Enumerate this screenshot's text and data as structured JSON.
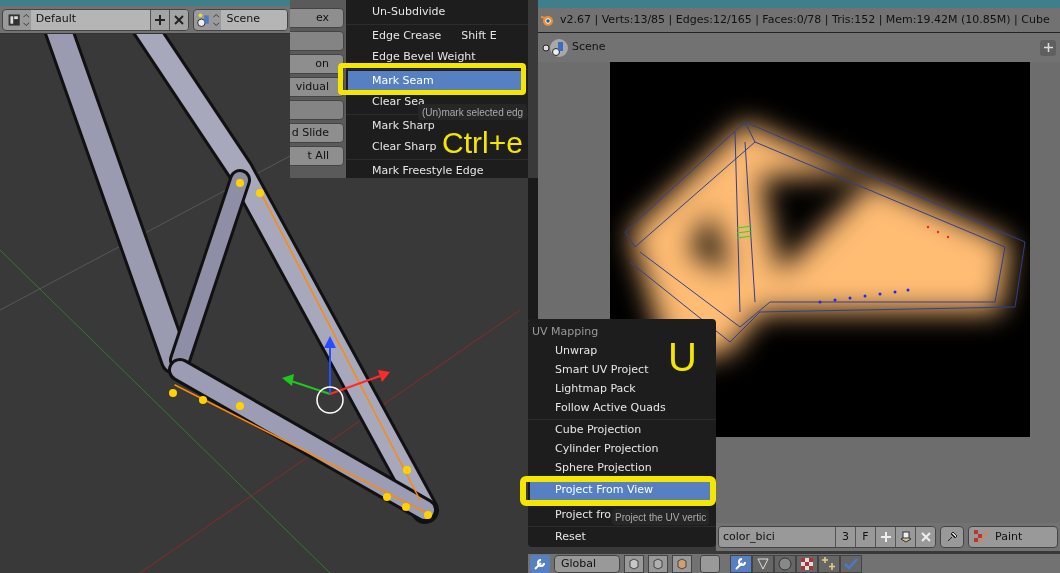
{
  "viewport_header": {
    "layout_menu": "Default",
    "scene_menu": "Scene"
  },
  "tool_buttons": [
    {
      "kind": "label",
      "label": "ex"
    },
    {
      "kind": "blank"
    },
    {
      "kind": "label",
      "label": "on"
    },
    {
      "kind": "label",
      "label": "vidual"
    },
    {
      "kind": "blank"
    },
    {
      "kind": "label",
      "label": "d Slide"
    },
    {
      "kind": "label",
      "label": "t All"
    }
  ],
  "edges_menu": {
    "groups": [
      [
        {
          "label": "Un-Subdivide",
          "selected": false
        }
      ],
      [
        {
          "label": "Edge Crease",
          "shortcut": "Shift E",
          "selected": false
        },
        {
          "label": "Edge Bevel Weight",
          "selected": false
        }
      ],
      [
        {
          "label": "Mark Seam",
          "selected": true
        },
        {
          "label": "Clear Sea",
          "selected": false
        }
      ],
      [
        {
          "label": "Mark Sharp",
          "selected": false
        },
        {
          "label": "Clear Sharp",
          "selected": false
        }
      ],
      [
        {
          "label": "Mark Freestyle Edge",
          "selected": false
        }
      ]
    ],
    "tooltip": "(Un)mark selected edg",
    "annotation": "Ctrl+e"
  },
  "info_header": {
    "stats": "v2.67 | Verts:13/85 | Edges:12/165 | Faces:0/78 | Tris:152 | Mem:19.42M (10.85M) | Cube"
  },
  "outliner": {
    "scene": "Scene"
  },
  "uv_menu": {
    "title": "UV Mapping",
    "groups": [
      [
        {
          "label": "Unwrap",
          "selected": false
        },
        {
          "label": "Smart UV Project",
          "selected": false
        },
        {
          "label": "Lightmap Pack",
          "selected": false
        },
        {
          "label": "Follow Active Quads",
          "selected": false
        }
      ],
      [
        {
          "label": "Cube Projection",
          "selected": false
        },
        {
          "label": "Cylinder Projection",
          "selected": false
        },
        {
          "label": "Sphere Projection",
          "selected": false
        }
      ],
      [
        {
          "label": "Project From View",
          "selected": true
        },
        {
          "label": "Project fro",
          "selected": false
        }
      ],
      [
        {
          "label": "Reset",
          "selected": false
        }
      ]
    ],
    "tooltip": "Project the UV vertic",
    "annotation": "U"
  },
  "image_header": {
    "image_name": "color_bici",
    "users": "3",
    "fake_user": "F",
    "mode": "Paint"
  },
  "view3d_footer": {
    "orientation": "Global"
  }
}
